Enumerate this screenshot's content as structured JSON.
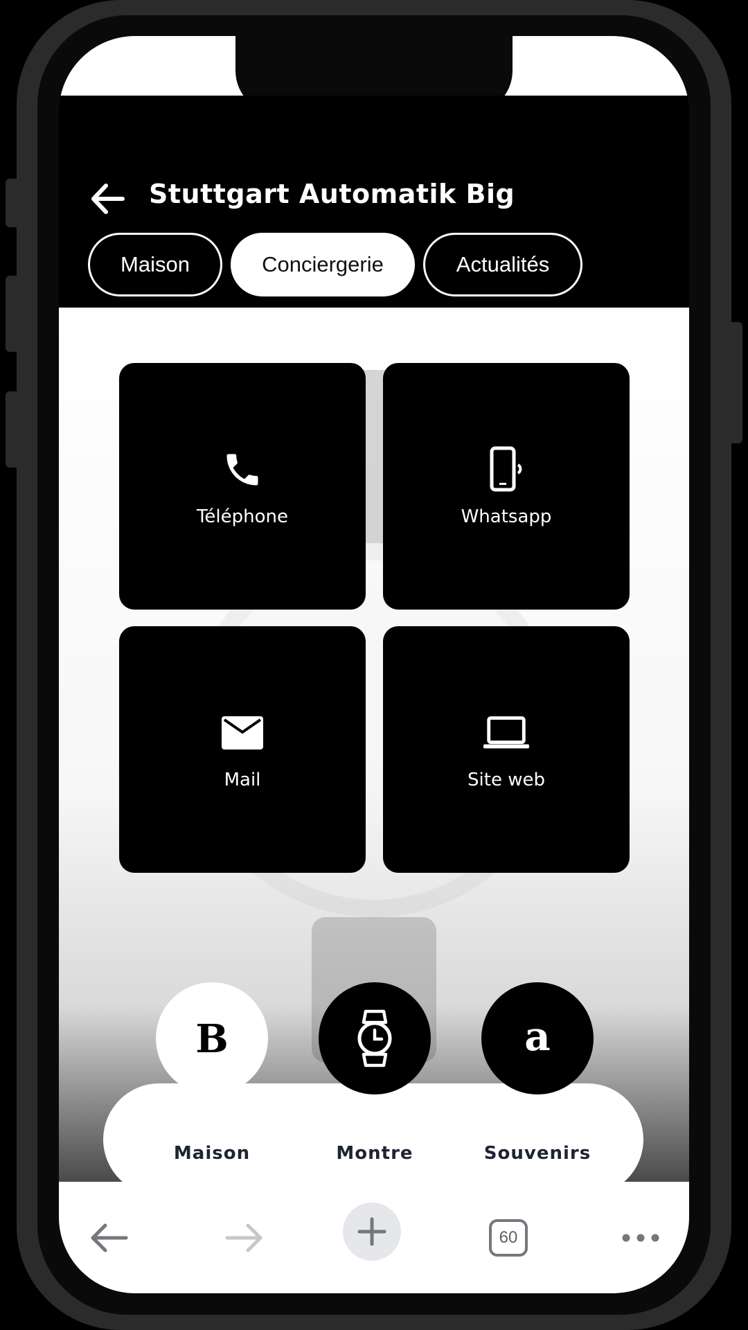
{
  "header": {
    "title": "Stuttgart Automatik Big",
    "back_icon": "arrow-left-icon"
  },
  "tabs": [
    {
      "label": "Maison",
      "active": false
    },
    {
      "label": "Conciergerie",
      "active": true
    },
    {
      "label": "Actualités",
      "active": false
    }
  ],
  "tiles": [
    {
      "label": "Téléphone",
      "icon": "phone-icon"
    },
    {
      "label": "Whatsapp",
      "icon": "mobile-vibrate-icon"
    },
    {
      "label": "Mail",
      "icon": "envelope-icon"
    },
    {
      "label": "Site web",
      "icon": "laptop-icon"
    }
  ],
  "bottom_nav": [
    {
      "label": "Maison",
      "icon": "brand-b-icon",
      "selected": true
    },
    {
      "label": "Montre",
      "icon": "watch-icon",
      "selected": false
    },
    {
      "label": "Souvenirs",
      "icon": "brand-a-icon",
      "selected": false
    }
  ],
  "browser": {
    "tab_count": "60",
    "icons": [
      "back-arrow-icon",
      "forward-arrow-icon",
      "plus-icon",
      "tab-switcher-icon",
      "more-icon"
    ]
  },
  "colors": {
    "background": "#000000",
    "tile": "#000000",
    "nav_label": "#1e2433",
    "browser_icon": "#74777d"
  }
}
